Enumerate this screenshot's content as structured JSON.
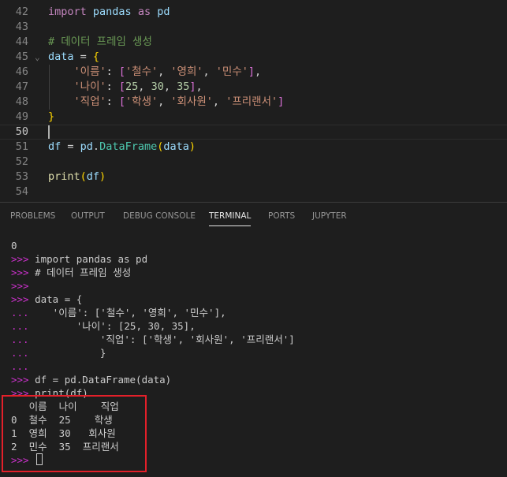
{
  "editor": {
    "lines": [
      {
        "num": "42",
        "segs": [
          {
            "c": "kw",
            "t": "import"
          },
          {
            "c": "txt",
            "t": " "
          },
          {
            "c": "id",
            "t": "pandas"
          },
          {
            "c": "txt",
            "t": " "
          },
          {
            "c": "kw",
            "t": "as"
          },
          {
            "c": "txt",
            "t": " "
          },
          {
            "c": "id",
            "t": "pd"
          }
        ]
      },
      {
        "num": "43",
        "segs": []
      },
      {
        "num": "44",
        "segs": [
          {
            "c": "cmt",
            "t": "# 데이터 프레임 생성"
          }
        ]
      },
      {
        "num": "45",
        "fold": true,
        "segs": [
          {
            "c": "id",
            "t": "data"
          },
          {
            "c": "op",
            "t": " = "
          },
          {
            "c": "br",
            "t": "{"
          }
        ]
      },
      {
        "num": "46",
        "segs": [
          {
            "c": "txt",
            "t": "    "
          },
          {
            "c": "str",
            "t": "'이름'"
          },
          {
            "c": "op",
            "t": ": "
          },
          {
            "c": "br2",
            "t": "["
          },
          {
            "c": "str",
            "t": "'철수'"
          },
          {
            "c": "op",
            "t": ", "
          },
          {
            "c": "str",
            "t": "'영희'"
          },
          {
            "c": "op",
            "t": ", "
          },
          {
            "c": "str",
            "t": "'민수'"
          },
          {
            "c": "br2",
            "t": "]"
          },
          {
            "c": "op",
            "t": ","
          }
        ]
      },
      {
        "num": "47",
        "segs": [
          {
            "c": "txt",
            "t": "    "
          },
          {
            "c": "str",
            "t": "'나이'"
          },
          {
            "c": "op",
            "t": ": "
          },
          {
            "c": "br2",
            "t": "["
          },
          {
            "c": "num",
            "t": "25"
          },
          {
            "c": "op",
            "t": ", "
          },
          {
            "c": "num",
            "t": "30"
          },
          {
            "c": "op",
            "t": ", "
          },
          {
            "c": "num",
            "t": "35"
          },
          {
            "c": "br2",
            "t": "]"
          },
          {
            "c": "op",
            "t": ","
          }
        ]
      },
      {
        "num": "48",
        "segs": [
          {
            "c": "txt",
            "t": "    "
          },
          {
            "c": "str",
            "t": "'직업'"
          },
          {
            "c": "op",
            "t": ": "
          },
          {
            "c": "br2",
            "t": "["
          },
          {
            "c": "str",
            "t": "'학생'"
          },
          {
            "c": "op",
            "t": ", "
          },
          {
            "c": "str",
            "t": "'회사원'"
          },
          {
            "c": "op",
            "t": ", "
          },
          {
            "c": "str",
            "t": "'프리랜서'"
          },
          {
            "c": "br2",
            "t": "]"
          }
        ]
      },
      {
        "num": "49",
        "segs": [
          {
            "c": "br",
            "t": "}"
          }
        ]
      },
      {
        "num": "50",
        "current": true,
        "segs": []
      },
      {
        "num": "51",
        "segs": [
          {
            "c": "id",
            "t": "df"
          },
          {
            "c": "op",
            "t": " = "
          },
          {
            "c": "id",
            "t": "pd"
          },
          {
            "c": "op",
            "t": "."
          },
          {
            "c": "cls",
            "t": "DataFrame"
          },
          {
            "c": "br",
            "t": "("
          },
          {
            "c": "id",
            "t": "data"
          },
          {
            "c": "br",
            "t": ")"
          }
        ]
      },
      {
        "num": "52",
        "segs": []
      },
      {
        "num": "53",
        "segs": [
          {
            "c": "fn",
            "t": "print"
          },
          {
            "c": "br",
            "t": "("
          },
          {
            "c": "id",
            "t": "df"
          },
          {
            "c": "br",
            "t": ")"
          }
        ]
      },
      {
        "num": "54",
        "segs": []
      }
    ]
  },
  "panel": {
    "tabs": [
      "PROBLEMS",
      "OUTPUT",
      "DEBUG CONSOLE",
      "TERMINAL",
      "PORTS",
      "JUPYTER"
    ],
    "active_tab": "TERMINAL"
  },
  "terminal": {
    "lines": [
      {
        "p": "",
        "t": "0"
      },
      {
        "p": ">>>",
        "t": " import pandas as pd"
      },
      {
        "p": ">>>",
        "t": " # 데이터 프레임 생성"
      },
      {
        "p": ">>>",
        "t": ""
      },
      {
        "p": ">>>",
        "t": " data = {"
      },
      {
        "p": "...",
        "t": "    '이름': ['철수', '영희', '민수'],"
      },
      {
        "p": "...",
        "t": "        '나이': [25, 30, 35],"
      },
      {
        "p": "...",
        "t": "            '직업': ['학생', '회사원', '프리랜서']"
      },
      {
        "p": "...",
        "t": "            }"
      },
      {
        "p": "...",
        "t": ""
      },
      {
        "p": ">>>",
        "t": " df = pd.DataFrame(data)"
      },
      {
        "p": ">>>",
        "t": " print(df)"
      },
      {
        "p": "",
        "t": "   이름  나이    직업"
      },
      {
        "p": "",
        "t": "0  철수  25    학생"
      },
      {
        "p": "",
        "t": "1  영희  30   회사원"
      },
      {
        "p": "",
        "t": "2  민수  35  프리랜서"
      },
      {
        "p": ">>>",
        "t": " ",
        "cursor": true
      }
    ]
  }
}
